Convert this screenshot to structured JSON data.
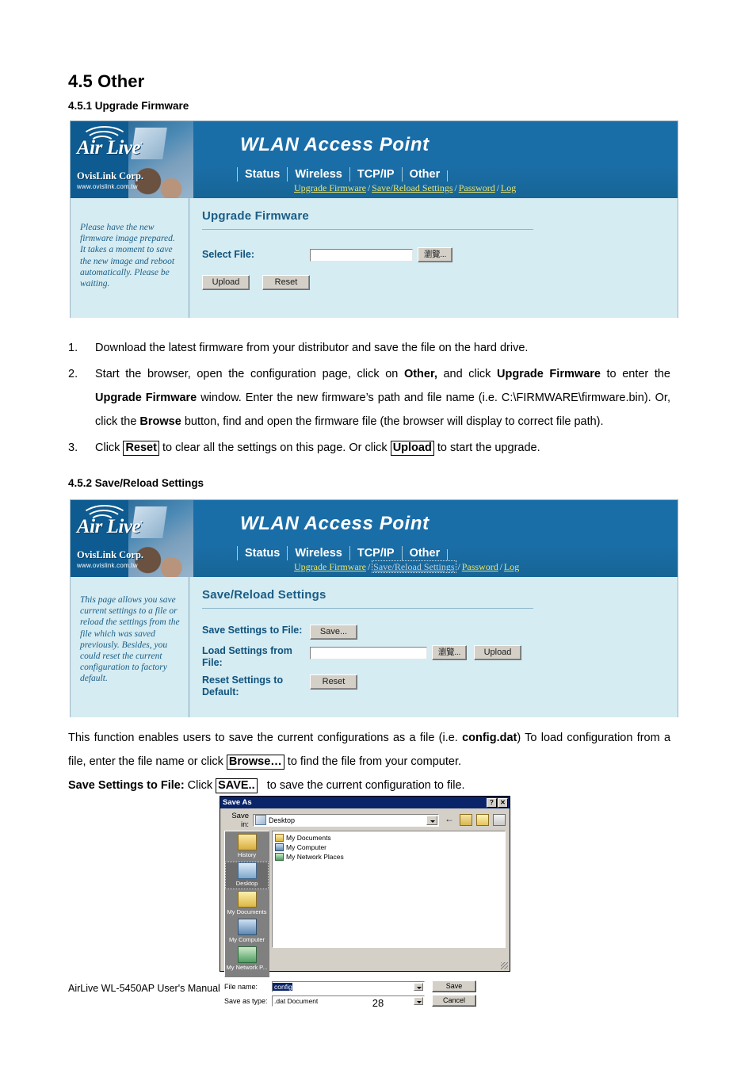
{
  "document": {
    "section_title": "4.5 Other",
    "subsection_1": "4.5.1 Upgrade Firmware",
    "subsection_2": "4.5.2 Save/Reload Settings",
    "footer_text": "AirLive WL-5450AP User's Manual",
    "page_number": "28"
  },
  "router_ui": {
    "brand": "Air Live",
    "brand_dot": "·",
    "company": "OvisLink Corp.",
    "website": "www.ovislink.com.tw",
    "banner_title": "WLAN Access Point",
    "tabs": [
      "Status",
      "Wireless",
      "TCP/IP",
      "Other"
    ],
    "subnav": [
      "Upgrade Firmware",
      "Save/Reload Settings",
      "Password",
      "Log"
    ],
    "subnav_separator": "/"
  },
  "upgrade_panel": {
    "title": "Upgrade Firmware",
    "help_text": "Please have the new firmware image prepared. It takes a moment to save the new image and reboot automatically. Please be waiting.",
    "select_file_label": "Select File:",
    "select_file_value": "",
    "browse_button": "瀏覽...",
    "upload_button": "Upload",
    "reset_button": "Reset"
  },
  "savereload_panel": {
    "title": "Save/Reload Settings",
    "help_text": "This page allows you save current settings to a file or reload the settings from the file which was saved previously. Besides, you could reset the current configuration to factory default.",
    "save_label": "Save Settings to File:",
    "save_button": "Save...",
    "load_label": "Load Settings from File:",
    "load_value": "",
    "browse_button": "瀏覽...",
    "upload_button": "Upload",
    "reset_label": "Reset Settings to Default:",
    "reset_button": "Reset"
  },
  "instructions": {
    "items": [
      {
        "num": "1.",
        "html": "Download the latest firmware from your distributor and save the file on the hard drive."
      },
      {
        "num": "2.",
        "html": "Start the browser, open the configuration page, click on <b>Other,</b> and click <b>Upgrade Firmware</b> to enter the <b>Upgrade Firmware</b> window. Enter the new firmware’s path and file name (i.e. C:\\FIRMWARE\\firmware.bin). Or, click the <b>Browse</b> button, find and open the firmware file (the browser will display to correct file path)."
      },
      {
        "num": "3.",
        "html": "Click <span class=\"boxed\">Reset</span> to clear all the settings on this page. Or click <span class=\"boxed\">Upload</span> to start the upgrade."
      }
    ]
  },
  "paragraphs": {
    "p1": "This function enables users to save the current configurations as a file (i.e. <b>config.dat</b>) To load configuration from a file, enter the file name or click <span class=\"boxed\">Browse…</span> to find the file from your computer.",
    "p2": "<b>Save Settings to File:</b> Click <span class=\"boxed\">SAVE..</span>&nbsp; &nbsp;to save the current configuration to file."
  },
  "save_as_dialog": {
    "title": "Save As",
    "help_button": "?",
    "close_button": "✕",
    "save_in_label": "Save in:",
    "save_in_value": "Desktop",
    "file_items": [
      "My Documents",
      "My Computer",
      "My Network Places"
    ],
    "places": [
      "History",
      "Desktop",
      "My Documents",
      "My Computer",
      "My Network P..."
    ],
    "file_name_label": "File name:",
    "file_name_value": "config",
    "save_as_type_label": "Save as type:",
    "save_as_type_value": ".dat Document",
    "save_button": "Save",
    "cancel_button": "Cancel"
  },
  "colors": {
    "banner_blue": "#1a6ea8",
    "panel_blue": "#d5ecf2",
    "heading_blue": "#1a5d86",
    "link_yellow": "#e8e36a"
  }
}
